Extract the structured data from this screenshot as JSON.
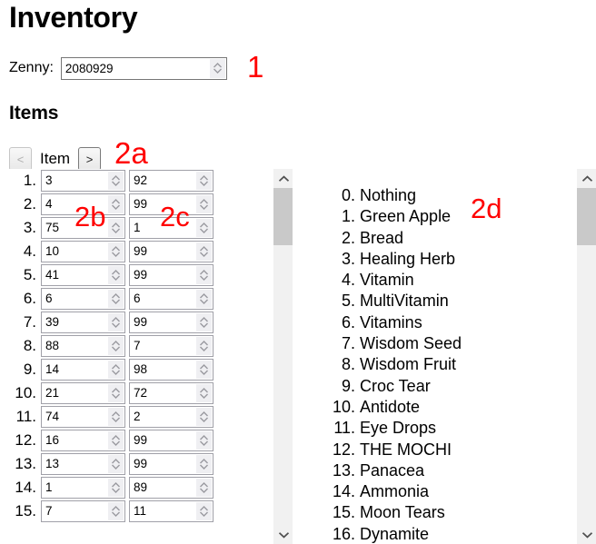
{
  "page": {
    "title": "Inventory"
  },
  "zenny": {
    "label": "Zenny:",
    "value": "2080929",
    "placeholder": ""
  },
  "items_section": {
    "heading": "Items",
    "nav": {
      "prev_label": "<",
      "title": "Item",
      "next_label": ">"
    }
  },
  "annotations": [
    {
      "id": "1",
      "text": "1",
      "color": "#ff0000"
    },
    {
      "id": "2a",
      "text": "2a",
      "color": "#ff0000"
    },
    {
      "id": "2b",
      "text": "2b",
      "color": "#ff0000"
    },
    {
      "id": "2c",
      "text": "2c",
      "color": "#ff0000"
    },
    {
      "id": "2d",
      "text": "2d",
      "color": "#ff0000"
    }
  ],
  "inventory_rows": [
    {
      "index": "1.",
      "item_id": "3",
      "quantity": "92"
    },
    {
      "index": "2.",
      "item_id": "4",
      "quantity": "99"
    },
    {
      "index": "3.",
      "item_id": "75",
      "quantity": "1"
    },
    {
      "index": "4.",
      "item_id": "10",
      "quantity": "99"
    },
    {
      "index": "5.",
      "item_id": "41",
      "quantity": "99"
    },
    {
      "index": "6.",
      "item_id": "6",
      "quantity": "6"
    },
    {
      "index": "7.",
      "item_id": "39",
      "quantity": "99"
    },
    {
      "index": "8.",
      "item_id": "88",
      "quantity": "7"
    },
    {
      "index": "9.",
      "item_id": "14",
      "quantity": "98"
    },
    {
      "index": "10.",
      "item_id": "21",
      "quantity": "72"
    },
    {
      "index": "11.",
      "item_id": "74",
      "quantity": "2"
    },
    {
      "index": "12.",
      "item_id": "16",
      "quantity": "99"
    },
    {
      "index": "13.",
      "item_id": "13",
      "quantity": "99"
    },
    {
      "index": "14.",
      "item_id": "1",
      "quantity": "89"
    },
    {
      "index": "15.",
      "item_id": "7",
      "quantity": "11"
    }
  ],
  "item_names": [
    {
      "num": "0.",
      "name": "Nothing"
    },
    {
      "num": "1.",
      "name": "Green Apple"
    },
    {
      "num": "2.",
      "name": "Bread"
    },
    {
      "num": "3.",
      "name": "Healing Herb"
    },
    {
      "num": "4.",
      "name": "Vitamin"
    },
    {
      "num": "5.",
      "name": "MultiVitamin"
    },
    {
      "num": "6.",
      "name": "Vitamins"
    },
    {
      "num": "7.",
      "name": "Wisdom Seed"
    },
    {
      "num": "8.",
      "name": "Wisdom Fruit"
    },
    {
      "num": "9.",
      "name": "Croc Tear"
    },
    {
      "num": "10.",
      "name": "Antidote"
    },
    {
      "num": "11.",
      "name": "Eye Drops"
    },
    {
      "num": "12.",
      "name": "THE MOCHI"
    },
    {
      "num": "13.",
      "name": "Panacea"
    },
    {
      "num": "14.",
      "name": "Ammonia"
    },
    {
      "num": "15.",
      "name": "Moon Tears"
    },
    {
      "num": "16.",
      "name": "Dynamite"
    }
  ],
  "scrollbars": {
    "left": {
      "up_icon": "chevron-up-icon",
      "down_icon": "chevron-down-icon",
      "thumb_top_pct": 0,
      "thumb_height_pct": 17
    },
    "right": {
      "up_icon": "chevron-up-icon",
      "down_icon": "chevron-down-icon",
      "thumb_top_pct": 0,
      "thumb_height_pct": 17
    }
  }
}
